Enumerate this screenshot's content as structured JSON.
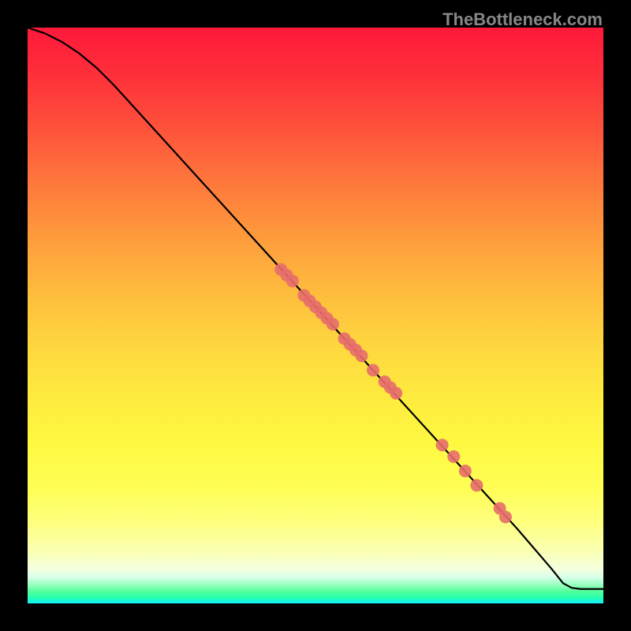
{
  "watermark": "TheBottleneck.com",
  "chart_data": {
    "type": "line",
    "title": "",
    "xlabel": "",
    "ylabel": "",
    "xlim": [
      0,
      100
    ],
    "ylim": [
      0,
      100
    ],
    "curve": [
      {
        "x": 0,
        "y": 100
      },
      {
        "x": 3,
        "y": 99
      },
      {
        "x": 6,
        "y": 97.5
      },
      {
        "x": 9,
        "y": 95.5
      },
      {
        "x": 12,
        "y": 93
      },
      {
        "x": 15,
        "y": 90
      },
      {
        "x": 20,
        "y": 84.5
      },
      {
        "x": 25,
        "y": 79
      },
      {
        "x": 30,
        "y": 73.5
      },
      {
        "x": 35,
        "y": 68
      },
      {
        "x": 40,
        "y": 62.5
      },
      {
        "x": 45,
        "y": 57
      },
      {
        "x": 50,
        "y": 51.5
      },
      {
        "x": 55,
        "y": 46
      },
      {
        "x": 60,
        "y": 40.5
      },
      {
        "x": 65,
        "y": 35
      },
      {
        "x": 70,
        "y": 29.5
      },
      {
        "x": 75,
        "y": 24
      },
      {
        "x": 80,
        "y": 18.5
      },
      {
        "x": 85,
        "y": 13
      },
      {
        "x": 88,
        "y": 9.5
      },
      {
        "x": 91,
        "y": 6
      },
      {
        "x": 93,
        "y": 3.5
      },
      {
        "x": 94.5,
        "y": 2.7
      },
      {
        "x": 96,
        "y": 2.5
      },
      {
        "x": 98,
        "y": 2.5
      },
      {
        "x": 100,
        "y": 2.5
      }
    ],
    "points": [
      {
        "x": 44,
        "y": 58
      },
      {
        "x": 45,
        "y": 57
      },
      {
        "x": 46,
        "y": 56
      },
      {
        "x": 48,
        "y": 53.5
      },
      {
        "x": 49,
        "y": 52.5
      },
      {
        "x": 50,
        "y": 51.5
      },
      {
        "x": 51,
        "y": 50.5
      },
      {
        "x": 52,
        "y": 49.5
      },
      {
        "x": 53,
        "y": 48.5
      },
      {
        "x": 55,
        "y": 46
      },
      {
        "x": 56,
        "y": 45
      },
      {
        "x": 57,
        "y": 44
      },
      {
        "x": 58,
        "y": 43
      },
      {
        "x": 60,
        "y": 40.5
      },
      {
        "x": 62,
        "y": 38.5
      },
      {
        "x": 63,
        "y": 37.5
      },
      {
        "x": 64,
        "y": 36.5
      },
      {
        "x": 72,
        "y": 27.5
      },
      {
        "x": 74,
        "y": 25.5
      },
      {
        "x": 76,
        "y": 23
      },
      {
        "x": 78,
        "y": 20.5
      },
      {
        "x": 82,
        "y": 16.5
      },
      {
        "x": 83,
        "y": 15
      }
    ],
    "point_color": "#e76d6c",
    "point_radius_px": 8
  }
}
